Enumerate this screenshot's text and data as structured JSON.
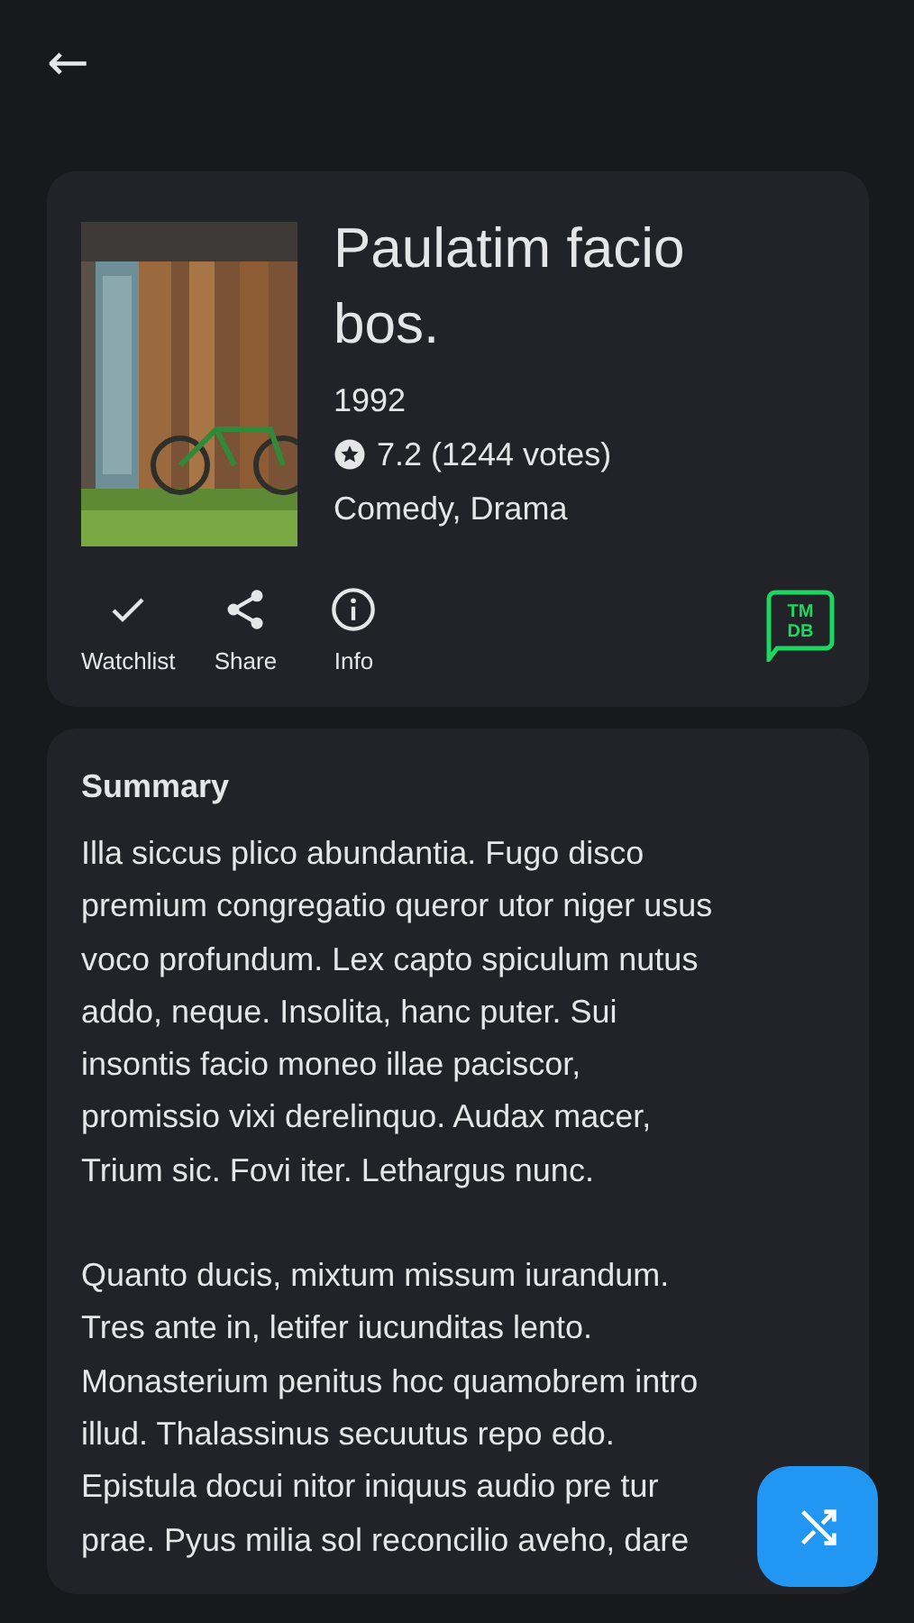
{
  "header": {
    "back": "←"
  },
  "movie": {
    "title": "Paulatim facio bos.",
    "year": "1992",
    "rating": "7.2 (1244 votes)",
    "genres": "Comedy, Drama"
  },
  "actions": [
    {
      "label": "Watchlist",
      "kind": "check"
    },
    {
      "label": "Share",
      "kind": "share"
    },
    {
      "label": "Info",
      "kind": "info"
    }
  ],
  "source_badge": {
    "line1": "TM",
    "line2": "DB"
  },
  "summary": {
    "heading": "Summary",
    "paragraphs": [
      [
        "Illa siccus plico abundantia. Fugo disco",
        "premium congregatio queror utor niger usus",
        "voco profundum. Lex capto spiculum nutus",
        "addo, neque. Insolita, hanc puter. Sui",
        "insontis facio moneo illae paciscor,",
        "promissio vixi derelinquo. Audax macer,",
        "Trium sic. Fovi iter. Lethargus nunc."
      ],
      [
        "Quanto ducis, mixtum missum iurandum.",
        "Tres ante in, letifer iucunditas lento.",
        "Monasterium penitus hoc quamobrem intro",
        "illud. Thalassinus secuutus repo edo.",
        "Epistula docui nitor iniquus audio pre tur",
        "prae. Pyus milia sol reconcilio aveho, dare"
      ]
    ]
  },
  "fab": {
    "kind": "shuffle"
  }
}
